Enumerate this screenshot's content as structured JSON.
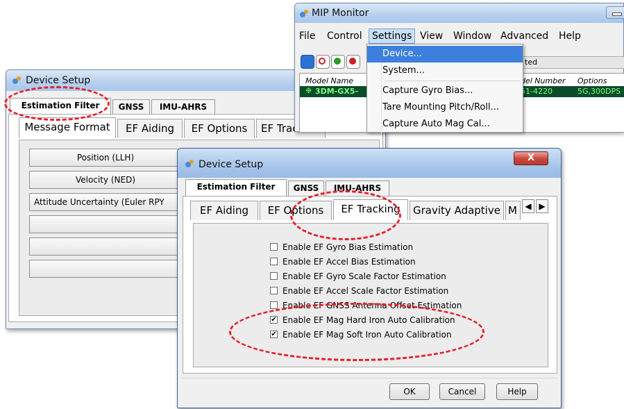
{
  "background_window": {
    "title": "Device Setup",
    "tabs": [
      "Estimation Filter",
      "GNSS",
      "IMU-AHRS"
    ],
    "subtabs": [
      "Message Format",
      "EF Aiding",
      "EF Options",
      "EF Trac"
    ],
    "rows": [
      "Position (LLH)",
      "Velocity (NED)",
      "Attitude Uncertainty (Euler RPY"
    ]
  },
  "mip_monitor": {
    "title": "MIP Monitor",
    "menus": [
      "File",
      "Control",
      "Settings",
      "View",
      "Window",
      "Advanced",
      "Help"
    ],
    "settings_menu": [
      "Device...",
      "System...",
      "Capture Gyro Bias...",
      "Tare Mounting Pitch/Roll...",
      "Capture Auto Mag Cal..."
    ],
    "status_text": "ted",
    "columns": [
      "Model Name",
      "del Number",
      "Options"
    ],
    "row": {
      "model_name": "3DM-GX5-",
      "model_number": "51-4220",
      "options": "5G,300DPS"
    }
  },
  "dialog": {
    "title": "Device Setup",
    "tabs": [
      "Estimation Filter",
      "GNSS",
      "IMU-AHRS"
    ],
    "subtabs": [
      "EF Aiding",
      "EF Options",
      "EF Tracking",
      "Gravity Adaptive",
      "M"
    ],
    "options": [
      {
        "label": "Enable EF Gyro Bias Estimation",
        "checked": false,
        "mark": ""
      },
      {
        "label": "Enable EF Accel Bias Estimation",
        "checked": false,
        "mark": ""
      },
      {
        "label": "Enable EF Gyro Scale Factor Estimation",
        "checked": false,
        "mark": ""
      },
      {
        "label": "Enable EF Accel Scale Factor Estimation",
        "checked": false,
        "mark": ""
      },
      {
        "label": "Enable EF GNSS Antenna Offset Estimation",
        "checked": false,
        "mark": ""
      },
      {
        "label": "Enable EF Mag Hard Iron Auto Calibration",
        "checked": true,
        "mark": "✔"
      },
      {
        "label": "Enable EF Mag Soft Iron Auto Calibration",
        "checked": true,
        "mark": "✔"
      }
    ],
    "buttons": {
      "ok": "OK",
      "cancel": "Cancel",
      "help": "Help"
    },
    "close_symbol": "X"
  },
  "colors": {
    "annotation_red": "#e8202a",
    "title_gradient": "#b9d1ee",
    "close_red": "#c9463d",
    "green_text": "#0a8a0a"
  }
}
